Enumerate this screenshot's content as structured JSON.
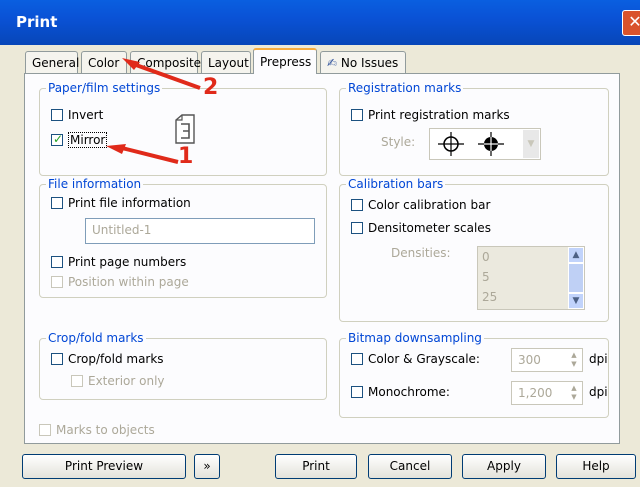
{
  "window": {
    "title": "Print",
    "close_glyph": "✕"
  },
  "tabs": [
    "General",
    "Color",
    "Composite",
    "Layout",
    "Prepress",
    "No Issues"
  ],
  "paper": {
    "label": "Paper/film settings",
    "invert": "Invert",
    "mirror": "Mirror"
  },
  "fileinfo": {
    "label": "File information",
    "print_file_info": "Print file information",
    "file_value": "Untitled-1",
    "print_page_numbers": "Print page numbers",
    "position_within_page": "Position within page"
  },
  "crop": {
    "label": "Crop/fold marks",
    "crop_fold": "Crop/fold marks",
    "exterior_only": "Exterior only"
  },
  "marks_to_objects": "Marks to objects",
  "registration": {
    "label": "Registration marks",
    "print_reg": "Print registration marks",
    "style_label": "Style:"
  },
  "calibration": {
    "label": "Calibration bars",
    "color_cal": "Color calibration bar",
    "densitometer": "Densitometer scales",
    "densities_label": "Densities:",
    "densities": [
      "0",
      "5",
      "25"
    ]
  },
  "bitmap": {
    "label": "Bitmap downsampling",
    "color_gray": "Color & Grayscale:",
    "color_value": "300",
    "color_unit": "dpi",
    "mono": "Monochrome:",
    "mono_value": "1,200",
    "mono_unit": "dpi"
  },
  "buttons": {
    "print_preview": "Print Preview",
    "print": "Print",
    "cancel": "Cancel",
    "apply": "Apply",
    "help": "Help",
    "forward": "»"
  },
  "callouts": {
    "one": "1",
    "two": "2"
  }
}
